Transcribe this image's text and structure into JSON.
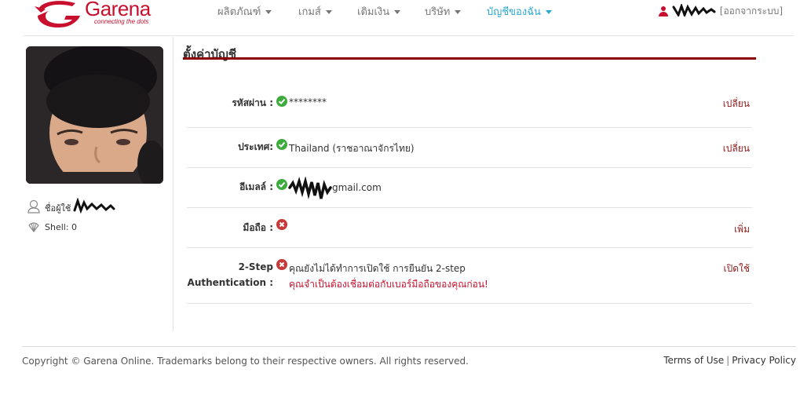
{
  "brand": {
    "name": "Garena",
    "tagline": "connecting the dots",
    "color": "#c8102e"
  },
  "nav": {
    "items": [
      {
        "label": "ผลิตภัณฑ์",
        "active": false
      },
      {
        "label": "เกมส์",
        "active": false
      },
      {
        "label": "เติมเงิน",
        "active": false
      },
      {
        "label": "บริษัท",
        "active": false
      },
      {
        "label": "บัญชีของฉัน",
        "active": true
      }
    ],
    "active_color": "#2aa7d0"
  },
  "user": {
    "logout_label": "[ออกจากระบบ]"
  },
  "sidebar": {
    "username_label": "ชื่อผู้ใช้",
    "shell_label": "Shell: 0"
  },
  "settings": {
    "title": "ตั้งค่าบัญชี",
    "rows": [
      {
        "label": "รหัสผ่าน :",
        "status": "ok",
        "value": "********",
        "action": "เปลี่ยน"
      },
      {
        "label": "ประเทศ:",
        "status": "ok",
        "value": "Thailand (ราชอาณาจักรไทย)",
        "action": "เปลี่ยน"
      },
      {
        "label": "อีเมลล์ :",
        "status": "ok",
        "value": "gmail.com",
        "action": ""
      },
      {
        "label": "มือถือ :",
        "status": "bad",
        "value": "",
        "action": "เพิ่ม"
      },
      {
        "label_line1": "2-Step",
        "label_line2": "Authentication :",
        "status": "bad",
        "value": "คุณยังไม่ได้ทำการเปิดใช้ การยืนยัน 2-step",
        "note": "คุณจำเป็นต้องเชื่อมต่อกับเบอร์มือถือของคุณก่อน!",
        "action": "เปิดใช้"
      }
    ]
  },
  "footer": {
    "copyright": "Copyright © Garena Online. Trademarks belong to their respective owners. All rights reserved.",
    "terms": "Terms of Use",
    "separator": "|",
    "privacy": "Privacy Policy"
  }
}
